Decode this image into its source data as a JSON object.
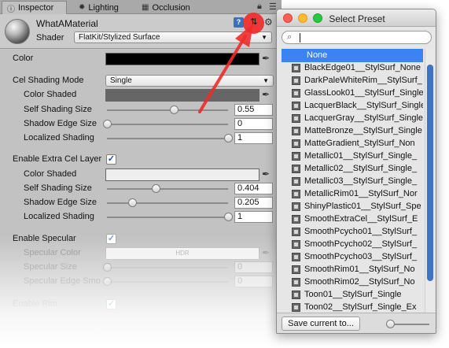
{
  "tabs": [
    {
      "label": "Inspector",
      "icon": "info-icon"
    },
    {
      "label": "Lighting",
      "icon": "lightbulb-icon"
    },
    {
      "label": "Occlusion",
      "icon": "grid-icon"
    }
  ],
  "header": {
    "material_name": "WhatAMaterial",
    "shader_label": "Shader",
    "shader_value": "FlatKit/Stylized Surface"
  },
  "props": {
    "color_label": "Color",
    "cel_mode_label": "Cel Shading Mode",
    "cel_mode_value": "Single",
    "color_shaded_label": "Color Shaded",
    "self_shading_label": "Self Shading Size",
    "self_shading_value": "0.55",
    "shadow_edge_label": "Shadow Edge Size",
    "shadow_edge_value": "0",
    "localized_label": "Localized Shading",
    "localized_value": "1",
    "extra_layer_label": "Enable Extra Cel Layer",
    "extra_color_label": "Color Shaded",
    "extra_self_label": "Self Shading Size",
    "extra_self_value": "0.404",
    "extra_shadow_label": "Shadow Edge Size",
    "extra_shadow_value": "0.205",
    "extra_localized_label": "Localized Shading",
    "extra_localized_value": "1",
    "specular_label": "Enable Specular",
    "specular_color_label": "Specular Color",
    "specular_color_value": "HDR",
    "specular_size_label": "Specular Size",
    "specular_size_value": "0",
    "specular_edge_label": "Specular Edge Smo",
    "specular_edge_value": "0",
    "rim_label": "Enable Rim"
  },
  "slider_levels": {
    "self_shading": 0.55,
    "shadow_edge": 0,
    "localized": 1,
    "extra_self": 0.404,
    "extra_shadow": 0.205,
    "extra_localized": 1
  },
  "colors": {
    "color_main": "#000000",
    "color_shaded": "#666666",
    "extra_color_shaded": "#eeeeee",
    "highlight": "#ef2b2b",
    "selection": "#3b82f2"
  },
  "preset_window": {
    "title": "Select Preset",
    "search_value": "",
    "items": [
      "None",
      "BlackEdge01__StylSurf_None",
      "DarkPaleWhiteRim__StylSurf_",
      "GlassLook01__StylSurf_Single",
      "LacquerBlack__StylSurf_Single",
      "LacquerGray__StylSurf_Single",
      "MatteBronze__StylSurf_Single",
      "MatteGradient_StylSurf_Non",
      "Metallic01__StylSurf_Single_",
      "Metallic02__StylSurf_Single_",
      "Metallic03__StylSurf_Single_",
      "MetallicRim01__StylSurf_Nor",
      "ShinyPlastic01__StylSurf_Spe",
      "SmoothExtraCel__StylSurf_E",
      "SmoothPcycho01__StylSurf_",
      "SmoothPcycho02__StylSurf_",
      "SmoothPcycho03__StylSurf_",
      "SmoothRim01__StylSurf_No",
      "SmoothRim02__StylSurf_No",
      "Toon01__StylSurf_Single",
      "Toon02__StylSurf_Single_Ex"
    ],
    "selected_index": 0,
    "save_button": "Save current to..."
  }
}
